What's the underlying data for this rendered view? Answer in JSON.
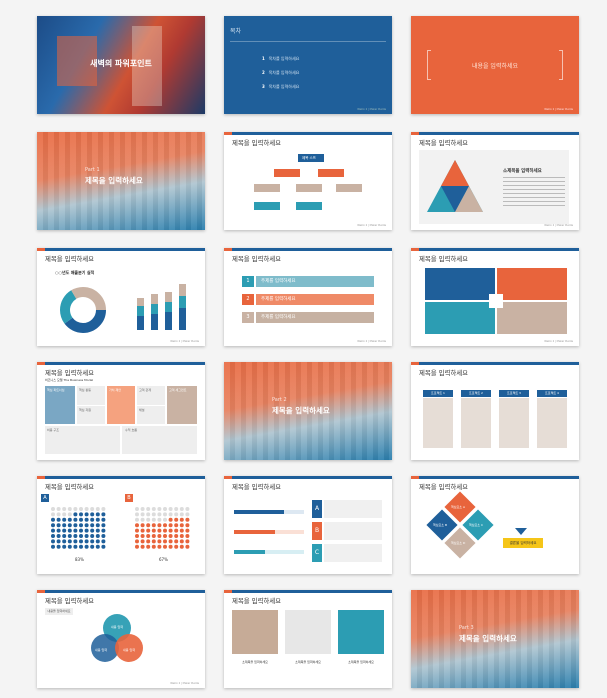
{
  "colors": {
    "blue": "#1f5f9a",
    "orange": "#e8643c",
    "teal": "#2c9db3",
    "tan": "#c9b2a3",
    "yellow": "#f5c518"
  },
  "footer": "Wekin 2 | Maker Puzzle",
  "slide_title": "제목을 입력하세요",
  "cover": {
    "title": "새벽의 파워포인트"
  },
  "toc": {
    "heading": "목차",
    "items": [
      {
        "n": "1",
        "label": "목차를 입력하세요"
      },
      {
        "n": "2",
        "label": "목차를 입력하세요"
      },
      {
        "n": "3",
        "label": "목차를 입력하세요"
      }
    ]
  },
  "content_slide": {
    "text": "내용을 입력하세요"
  },
  "sections": [
    {
      "part": "Part 1",
      "title": "제목을 입력하세요"
    },
    {
      "part": "Part 2",
      "title": "제목을 입력하세요"
    },
    {
      "part": "Part 3",
      "title": "제목을 입력하세요"
    }
  ],
  "org": {
    "box": "제목 스프"
  },
  "triangle": {
    "subtitle": "소제목을 입력하세요"
  },
  "chart_slide": {
    "left_title": "○○년도 매출분기 실적"
  },
  "topics": [
    {
      "n": "1",
      "label": "주제를 입력하세요"
    },
    {
      "n": "2",
      "label": "주제를 입력하세요"
    },
    {
      "n": "3",
      "label": "주제를 입력하세요"
    }
  ],
  "canvas": {
    "title": "비즈니스 모델 The Business Model",
    "cells": [
      "핵심 파트너십",
      "핵심 활동",
      "가치 제안",
      "고객 관계",
      "고객 세그먼트",
      "핵심 자원",
      "채널",
      "비용 구조",
      "수익 흐름"
    ]
  },
  "process": {
    "steps": [
      "프로젝트 1",
      "프로젝트 2",
      "프로젝트 3",
      "프로젝트 4"
    ]
  },
  "dots": {
    "a_label": "A",
    "b_label": "B",
    "a_pct": "83%",
    "b_pct": "67%",
    "a_value": 0.83,
    "b_value": 0.67
  },
  "bars": {
    "labels": [
      "A",
      "B",
      "C"
    ],
    "values": [
      0.72,
      0.58,
      0.44
    ]
  },
  "diamonds": {
    "a": "핵심요소 A",
    "b": "핵심요소 B",
    "c": "핵심요소 C",
    "d": "핵심요소 D",
    "result": "결론을 입력하세요"
  },
  "venn": {
    "left_box": "내용을 입력하세요",
    "circles": [
      "내용 입력",
      "내용 입력",
      "내용 입력"
    ]
  },
  "photos": {
    "captions": [
      "소제목을 입력하세요",
      "소제목을 입력하세요",
      "소제목을 입력하세요"
    ]
  }
}
